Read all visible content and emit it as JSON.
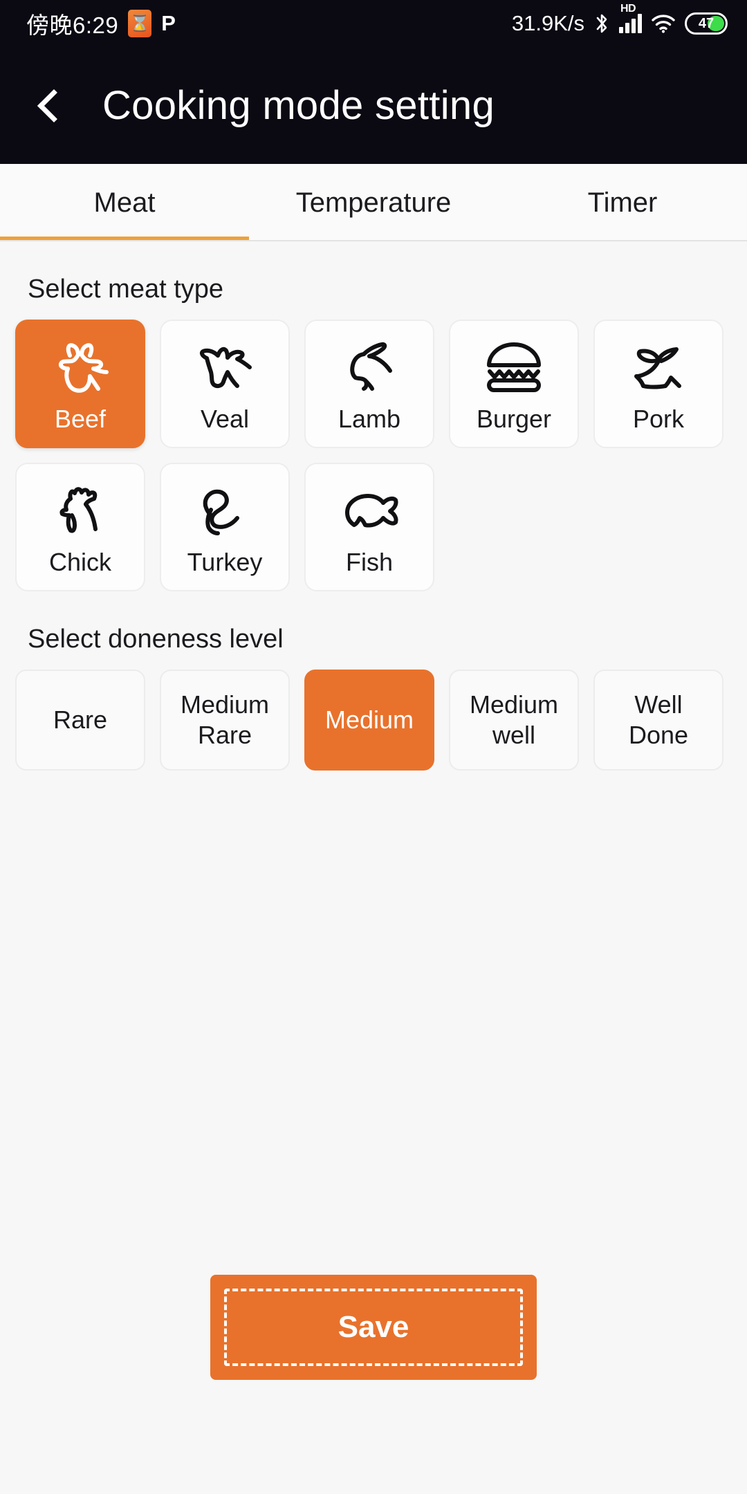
{
  "statusbar": {
    "time": "傍晚6:29",
    "app_icon": "hourglass-icon",
    "p_icon": "P",
    "network_speed": "31.9K/s",
    "bluetooth_icon": "bluetooth-icon",
    "hd_label": "HD",
    "signal_icon": "signal-bars-icon",
    "wifi_icon": "wifi-icon",
    "battery_level": "47"
  },
  "header": {
    "back_icon": "chevron-left-icon",
    "title": "Cooking mode setting"
  },
  "tabs": {
    "items": [
      {
        "label": "Meat",
        "active": true
      },
      {
        "label": "Temperature",
        "active": false
      },
      {
        "label": "Timer",
        "active": false
      }
    ],
    "accent_color": "#EFA03A"
  },
  "meat_section": {
    "label": "Select meat type",
    "items": [
      {
        "label": "Beef",
        "icon": "cow-head-icon",
        "selected": true
      },
      {
        "label": "Veal",
        "icon": "calf-head-icon",
        "selected": false
      },
      {
        "label": "Lamb",
        "icon": "lamb-head-icon",
        "selected": false
      },
      {
        "label": "Burger",
        "icon": "burger-icon",
        "selected": false
      },
      {
        "label": "Pork",
        "icon": "pig-icon",
        "selected": false
      },
      {
        "label": "Chick",
        "icon": "rooster-head-icon",
        "selected": false
      },
      {
        "label": "Turkey",
        "icon": "turkey-icon",
        "selected": false
      },
      {
        "label": "Fish",
        "icon": "fish-icon",
        "selected": false
      }
    ]
  },
  "doneness_section": {
    "label": "Select doneness level",
    "items": [
      {
        "label": "Rare",
        "selected": false
      },
      {
        "label": "Medium\nRare",
        "selected": false
      },
      {
        "label": "Medium",
        "selected": true
      },
      {
        "label": "Medium\nwell",
        "selected": false
      },
      {
        "label": "Well\nDone",
        "selected": false
      }
    ]
  },
  "footer": {
    "save_label": "Save",
    "accent_color": "#E8722C"
  }
}
